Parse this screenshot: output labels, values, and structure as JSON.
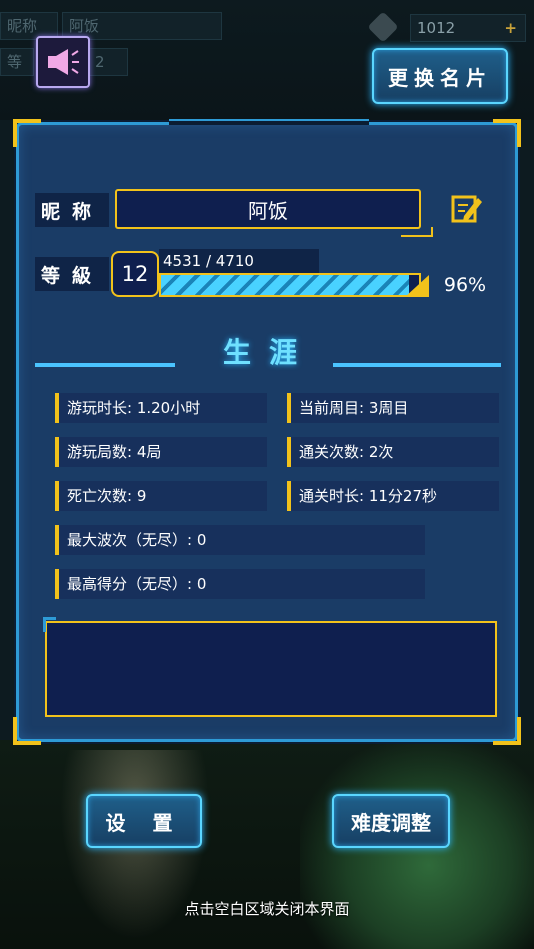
{
  "background": {
    "nickname_label": "昵称",
    "nickname_value": "阿饭",
    "level_label": "等",
    "level_value": "2",
    "coins": "1012",
    "add_symbol": "+"
  },
  "top": {
    "rename_button": "更换名片",
    "speaker_icon": "megaphone-icon"
  },
  "profile": {
    "nickname_label": "昵称",
    "nickname": "阿饭",
    "level_label": "等級",
    "level": "12",
    "xp_text": "4531 / 4710",
    "xp_current": 4531,
    "xp_max": 4710,
    "xp_percent": "96%",
    "edit_icon": "edit-note-icon"
  },
  "career": {
    "title": "生涯",
    "stats_left": [
      "游玩时长: 1.20小时",
      "游玩局数: 4局",
      "死亡次数: 9"
    ],
    "stats_right": [
      "当前周目: 3周目",
      "通关次数: 2次",
      "通关时长: 11分27秒"
    ],
    "stats_wide": [
      "最大波次（无尽）: 0",
      "最高得分（无尽）: 0"
    ]
  },
  "buttons": {
    "settings": "设 置",
    "difficulty": "难度调整"
  },
  "hint": "点击空白区域关闭本界面",
  "colors": {
    "accent_gold": "#f2c21b",
    "accent_cyan": "#4ac4ff",
    "panel_blue": "#1a3c66"
  }
}
